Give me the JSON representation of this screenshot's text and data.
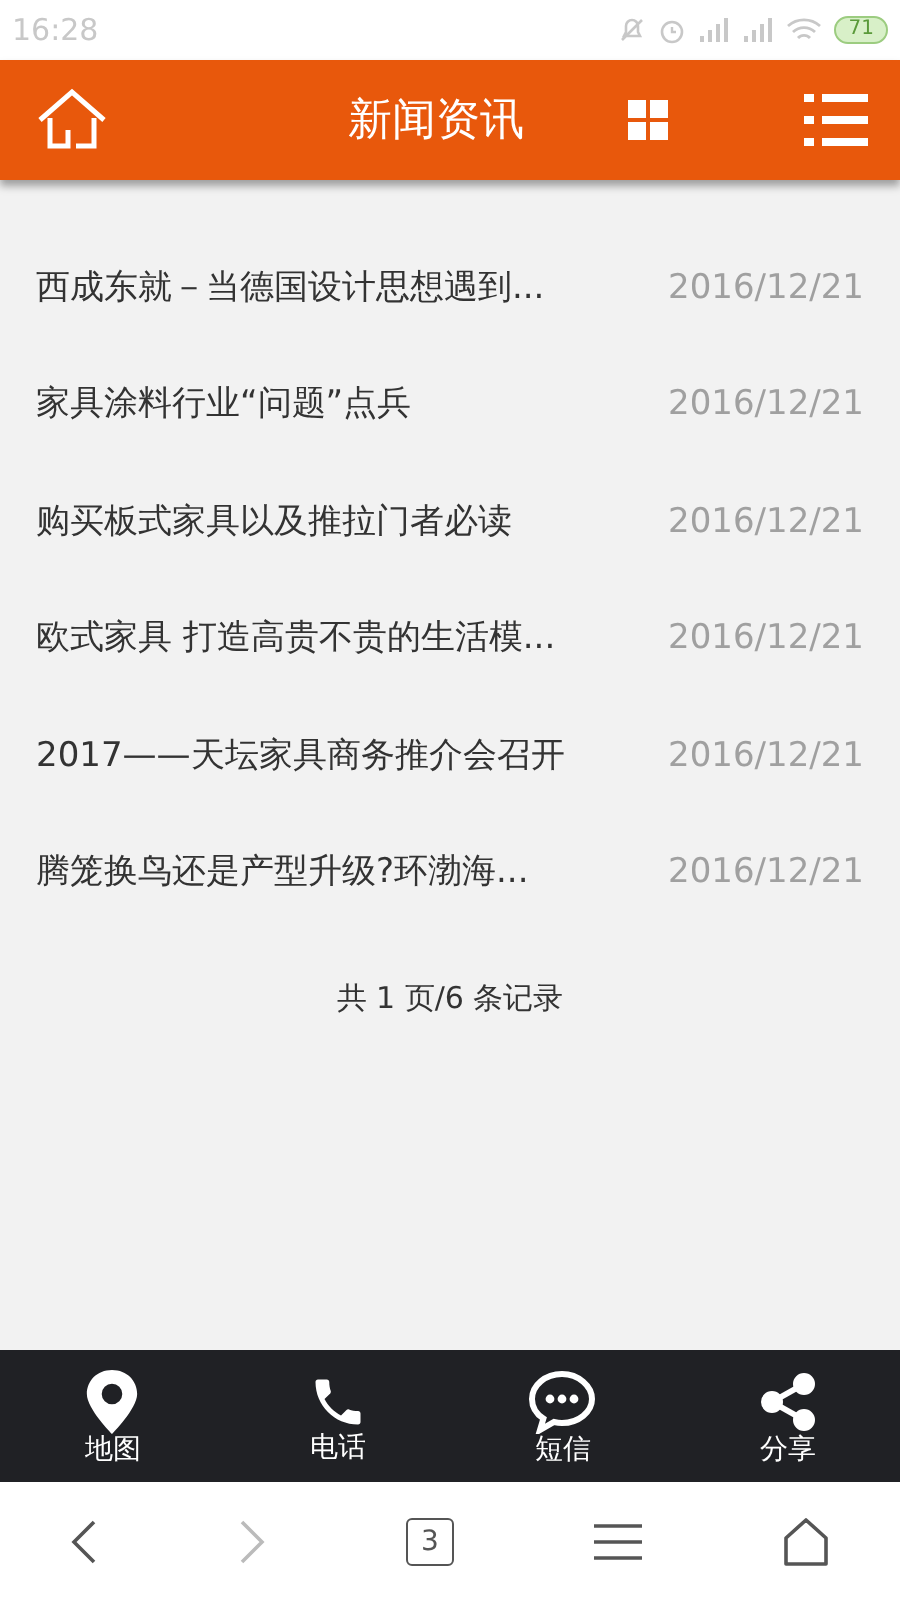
{
  "status_bar": {
    "time": "16:28",
    "battery": "71"
  },
  "header": {
    "title": "新闻资讯"
  },
  "news": [
    {
      "title": "西成东就－当德国设计思想遇到...",
      "date": "2016/12/21"
    },
    {
      "title": "家具涂料行业“问题”点兵",
      "date": "2016/12/21"
    },
    {
      "title": "购买板式家具以及推拉门者必读",
      "date": "2016/12/21"
    },
    {
      "title": "欧式家具 打造高贵不贵的生活模...",
      "date": "2016/12/21"
    },
    {
      "title": "2017——天坛家具商务推介会召开",
      "date": "2016/12/21"
    },
    {
      "title": "腾笼换鸟还是产型升级?环渤海...",
      "date": "2016/12/21"
    }
  ],
  "pagination": "共 1 页/6 条记录",
  "bottom_nav": [
    {
      "kind": "map",
      "label": "地图"
    },
    {
      "kind": "phone",
      "label": "电话"
    },
    {
      "kind": "sms",
      "label": "短信"
    },
    {
      "kind": "share",
      "label": "分享"
    }
  ],
  "browser_bar": {
    "tab_count": "3"
  }
}
